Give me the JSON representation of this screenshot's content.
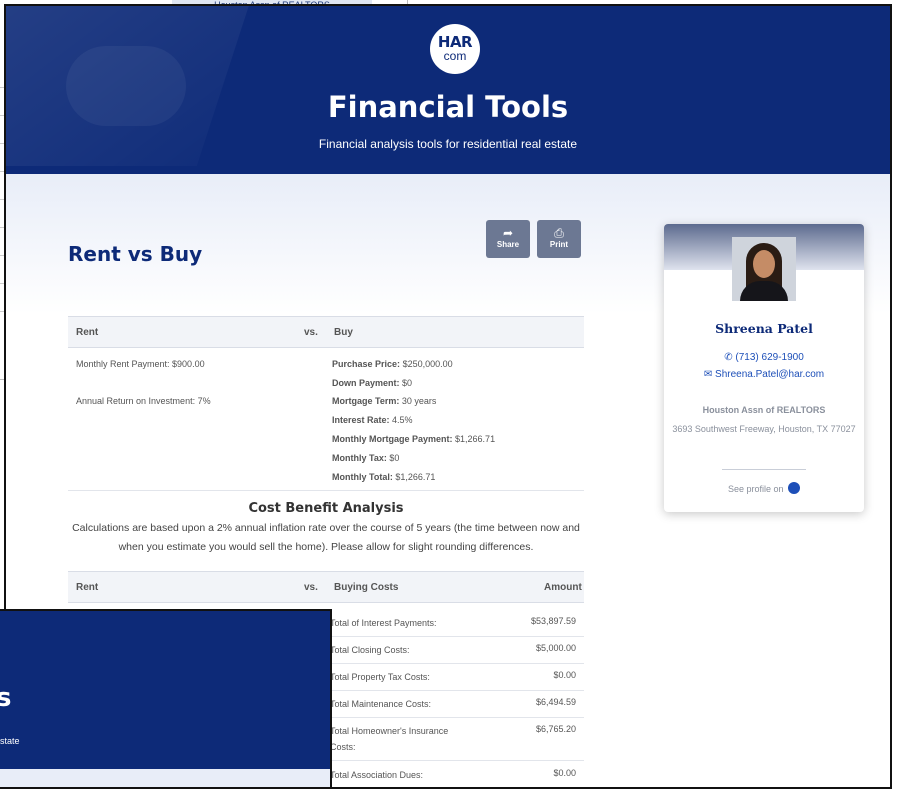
{
  "background_window": {
    "strip_text": "Houston Assn of REALTORS"
  },
  "header": {
    "logo_top": "HAR",
    "logo_bottom": "com",
    "title": "Financial Tools",
    "subtitle": "Financial analysis tools for residential real estate"
  },
  "page": {
    "title": "Rent vs Buy",
    "actions": [
      {
        "label": "Share",
        "icon": "share-icon"
      },
      {
        "label": "Print",
        "icon": "print-icon"
      }
    ]
  },
  "rent_vs_buy": {
    "headers": {
      "rent": "Rent",
      "vs": "vs.",
      "buy": "Buy"
    },
    "rent_items": [
      "Monthly Rent Payment: $900.00",
      "Annual Return on Investment: 7%"
    ],
    "buy_items": [
      {
        "label": "Purchase Price:",
        "value": "$250,000.00"
      },
      {
        "label": "Down Payment:",
        "value": "$0"
      },
      {
        "label": "Mortgage Term:",
        "value": "30 years"
      },
      {
        "label": "Interest Rate:",
        "value": "4.5%"
      },
      {
        "label": "Monthly Mortgage Payment:",
        "value": "$1,266.71"
      },
      {
        "label": "Monthly Tax:",
        "value": "$0"
      },
      {
        "label": "Monthly Total:",
        "value": "$1,266.71"
      }
    ]
  },
  "cost_benefit": {
    "title": "Cost Benefit Analysis",
    "description": "Calculations are based upon a 2% annual inflation rate over the course of 5 years (the time between now and when you estimate you would sell the home). Please allow for slight rounding differences.",
    "headers": {
      "rent": "Rent",
      "vs": "vs.",
      "buying_costs": "Buying Costs",
      "amount": "Amount"
    },
    "rows": [
      {
        "label": "Total of Interest Payments:",
        "amount": "$53,897.59"
      },
      {
        "label": "Total Closing Costs:",
        "amount": "$5,000.00"
      },
      {
        "label": "Total Property Tax Costs:",
        "amount": "$0.00"
      },
      {
        "label": "Total Maintenance Costs:",
        "amount": "$6,494.59"
      },
      {
        "label": "Total Homeowner's Insurance Costs:",
        "amount": "$6,765.20"
      },
      {
        "label": "Total Association Dues:",
        "amount": "$0.00"
      }
    ]
  },
  "agent": {
    "name": "Shreena Patel",
    "phone": "(713) 629-1900",
    "email": "Shreena.Patel@har.com",
    "org": "Houston Assn of REALTORS",
    "address": "3693 Southwest Freeway, Houston, TX 77027",
    "profile_link": "See profile on"
  },
  "front_window": {
    "big_text": "s",
    "small_text": "state"
  },
  "colors": {
    "brand_navy": "#0d2a78",
    "button_gray": "#6c7893",
    "link_blue": "#1d4fb8"
  }
}
